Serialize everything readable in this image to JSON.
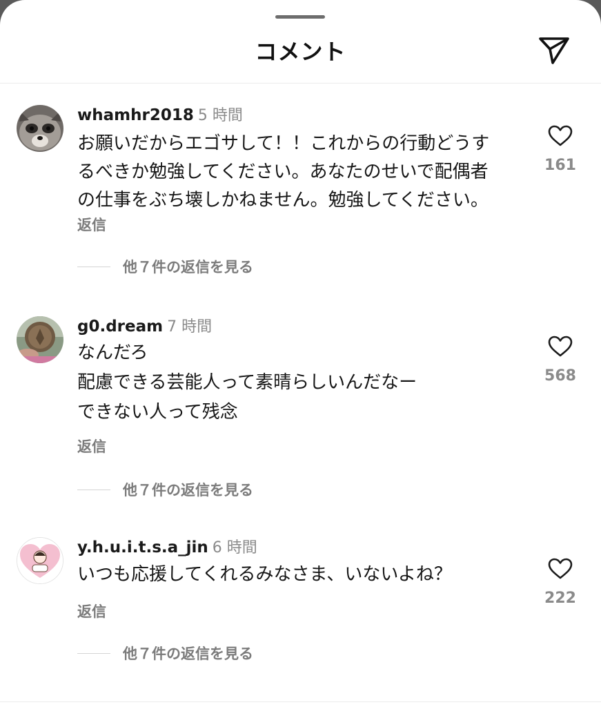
{
  "header": {
    "title": "コメント",
    "share_icon": "paper-plane-icon"
  },
  "comments": [
    {
      "username": "whamhr2018",
      "time": "5 時間",
      "lines": [
        "お願いだからエゴサして！！これからの行動どうす",
        "るべきか勉強してください。あなたのせいで配偶者",
        "の仕事をぶち壊しかねません。勉強してください。"
      ],
      "reply_label": "返信",
      "more_replies": "他７件の返信を見る",
      "likes": "161",
      "avatar": "raccoon-photo"
    },
    {
      "username": "g0.dream",
      "time": "7 時間",
      "lines": [
        "なんだろ",
        "配慮できる芸能人って素晴らしいんだなー",
        "できない人って残念"
      ],
      "reply_label": "返信",
      "more_replies": "他７件の返信を見る",
      "likes": "568",
      "avatar": "coin-photo"
    },
    {
      "username": "y.h.u.i.t.s.a_jin",
      "time": "6 時間",
      "lines": [
        "いつも応援してくれるみなさま、いないよね？"
      ],
      "reply_label": "返信",
      "more_replies": "他７件の返信を見る",
      "likes": "222",
      "avatar": "heart-illustration"
    }
  ],
  "colors": {
    "text": "#161616",
    "secondary": "#8a8a8a",
    "divider": "#ececec"
  }
}
